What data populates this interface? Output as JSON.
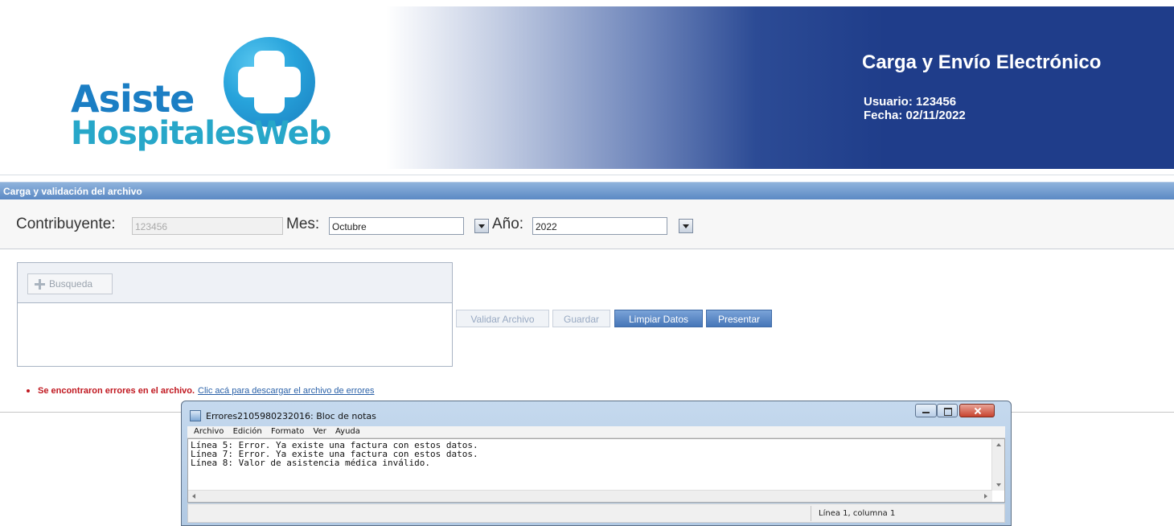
{
  "header": {
    "logo_line1": "Asiste",
    "logo_line2": "HospitalesWeb",
    "title": "Carga y Envío Electrónico",
    "user_line": "Usuario: 123456",
    "date_line": "Fecha: 02/11/2022"
  },
  "section": {
    "title": "Carga y validación del archivo"
  },
  "filters": {
    "contribuyente_label": "Contribuyente:",
    "contribuyente_value": "123456",
    "mes_label": "Mes:",
    "mes_value": "Octubre",
    "anio_label": "Año:",
    "anio_value": "2022"
  },
  "panel": {
    "busqueda_label": "Busqueda"
  },
  "actions": {
    "validar_label": "Validar Archivo",
    "guardar_label": "Guardar",
    "limpiar_label": "Limpiar Datos",
    "presentar_label": "Presentar"
  },
  "error": {
    "message": "Se encontraron errores en el archivo.",
    "link_text": "Clic acá para descargar el archivo de errores"
  },
  "notepad": {
    "title": "Errores2105980232016: Bloc de notas",
    "menu": [
      "Archivo",
      "Edición",
      "Formato",
      "Ver",
      "Ayuda"
    ],
    "lines": [
      "Línea 5: Error. Ya existe una factura con estos datos.",
      "Línea 7: Error. Ya existe una factura con estos datos.",
      "Línea 8: Valor de asistencia médica inválido."
    ],
    "status": "Línea 1, columna 1"
  },
  "colors": {
    "header_blue": "#1f3d8a",
    "logo_blue": "#1b7ec4",
    "logo_cyan": "#27a7c9",
    "button_active": "#4676b8",
    "error_red": "#c0171f",
    "link_blue": "#2a61a8"
  }
}
